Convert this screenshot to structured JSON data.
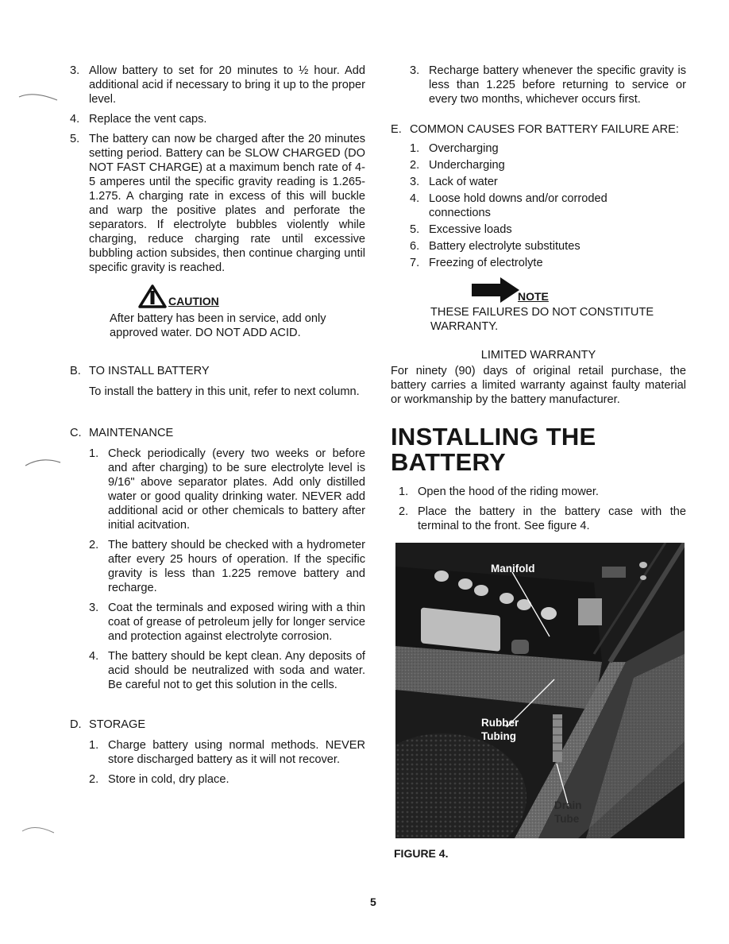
{
  "page_number": "5",
  "left_column": {
    "intro_items": [
      {
        "num": "3.",
        "text": "Allow battery to set for 20 minutes to ½ hour. Add additional acid if necessary to bring it up to the proper level."
      },
      {
        "num": "4.",
        "text": "Replace the vent caps."
      },
      {
        "num": "5.",
        "text": "The battery can now be charged after the 20 minutes setting period. Battery can be SLOW CHARGED (DO NOT FAST CHARGE) at a maximum bench rate of 4-5 amperes until the specific gravity reading is 1.265-1.275. A charging rate in excess of this will buckle and warp the positive plates and perforate the separators. If electrolyte bubbles violently while charging, reduce charging rate until excessive bubbling action subsides, then continue charging until specific gravity is reached."
      }
    ],
    "caution": {
      "icon": "warning-triangle-icon",
      "label": "CAUTION",
      "text": "After battery has been in service, add only approved water. DO NOT ADD ACID."
    },
    "section_b": {
      "letter": "B.",
      "title": "TO INSTALL BATTERY",
      "text": "To install the battery in this unit, refer to next column."
    },
    "section_c": {
      "letter": "C.",
      "title": "MAINTENANCE",
      "items": [
        {
          "num": "1.",
          "text": "Check periodically (every two weeks or before and after charging) to be sure electrolyte level is 9/16\" above separator plates. Add only distilled water or good quality drinking water. NEVER add additional acid or other chemicals to battery after initial acitvation."
        },
        {
          "num": "2.",
          "text": "The battery should be checked with a hydrometer after every 25 hours of operation. If the specific gravity is less than 1.225 remove battery and recharge."
        },
        {
          "num": "3.",
          "text": "Coat the terminals and exposed wiring with a thin coat of grease of petroleum jelly for longer service and protection against electrolyte corrosion."
        },
        {
          "num": "4.",
          "text": "The battery should be kept clean. Any deposits of acid should be neutralized with soda and water. Be careful not to get this solution in the cells."
        }
      ]
    },
    "section_d": {
      "letter": "D.",
      "title": "STORAGE",
      "items": [
        {
          "num": "1.",
          "text": "Charge battery using normal methods. NEVER store discharged battery as it will not recover."
        },
        {
          "num": "2.",
          "text": "Store in cold, dry place."
        }
      ]
    }
  },
  "right_column": {
    "storage_continued": [
      {
        "num": "3.",
        "text": "Recharge battery whenever the specific gravity is less than 1.225 before returning to service or every two months, whichever occurs first."
      }
    ],
    "section_e": {
      "letter": "E.",
      "title": "COMMON CAUSES FOR BATTERY FAILURE ARE:",
      "items": [
        {
          "num": "1.",
          "text": "Overcharging"
        },
        {
          "num": "2.",
          "text": "Undercharging"
        },
        {
          "num": "3.",
          "text": "Lack of water"
        },
        {
          "num": "4.",
          "text": "Loose hold downs and/or corroded connections"
        },
        {
          "num": "5.",
          "text": "Excessive loads"
        },
        {
          "num": "6.",
          "text": "Battery electrolyte substitutes"
        },
        {
          "num": "7.",
          "text": "Freezing of electrolyte"
        }
      ]
    },
    "note": {
      "icon": "arrow-right-icon",
      "label": "NOTE",
      "text": "THESE FAILURES DO NOT CONSTITUTE WARRANTY."
    },
    "warranty": {
      "title": "LIMITED WARRANTY",
      "text": "For ninety (90) days of original retail purchase, the battery carries a limited warranty against faulty material or workmanship by the battery manufacturer."
    },
    "installing": {
      "title_line1": "INSTALLING THE",
      "title_line2": "BATTERY",
      "items": [
        {
          "num": "1.",
          "text": "Open the hood of the riding mower."
        },
        {
          "num": "2.",
          "text": "Place the battery in the battery case with the terminal to the front. See figure 4."
        }
      ]
    },
    "figure": {
      "labels": {
        "manifold": "Manifold",
        "rubber_tubing_1": "Rubber",
        "rubber_tubing_2": "Tubing",
        "drain_tube_1": "Drain",
        "drain_tube_2": "Tube"
      },
      "caption": "FIGURE 4."
    }
  }
}
